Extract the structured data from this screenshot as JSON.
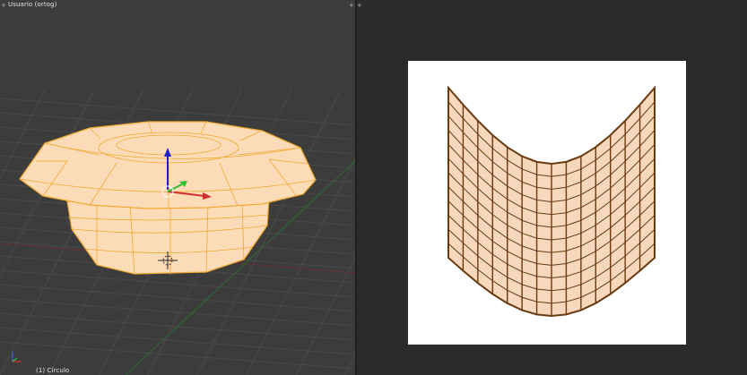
{
  "viewport_3d": {
    "title": "Usuario (ortog)",
    "object_label": "(1) Círculo",
    "corner_icon": "+",
    "colors": {
      "background": "#3c3c3c",
      "grid": "#4a4a4a",
      "mesh_fill": "#fcdcb8",
      "mesh_edge": "#f0a830",
      "x_axis": "#d03030",
      "y_axis": "#30c030",
      "z_axis": "#2020c0"
    }
  },
  "uv_editor": {
    "corner_icon": "+",
    "colors": {
      "image_background": "#ffffff",
      "uv_fill": "#f7d8bc",
      "uv_edge": "#6a3a10"
    }
  }
}
